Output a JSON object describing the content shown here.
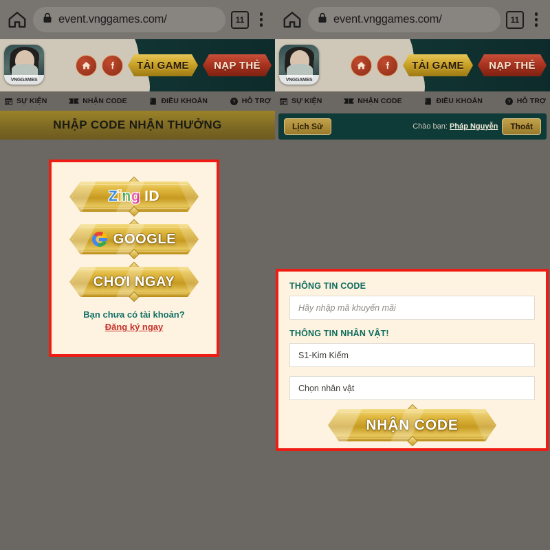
{
  "browser": {
    "url": "event.vnggames.com/",
    "tab_count": "11",
    "home_icon": "home-icon",
    "lock_icon": "lock-icon",
    "tabs_icon": "tab-counter-icon",
    "menu_icon": "kebab-menu-icon"
  },
  "game_header": {
    "logo_alt": "VNGGAMES",
    "logo_caption": "VNGGAMES",
    "home_icon": "home-icon",
    "facebook_icon": "facebook-icon",
    "download_label": "TẢI GAME",
    "topup_label": "NẠP THẺ"
  },
  "nav": [
    {
      "label": "SỰ KIỆN",
      "icon": "calendar-icon"
    },
    {
      "label": "NHẬN CODE",
      "icon": "ticket-icon"
    },
    {
      "label": "ĐIỀU KHOẢN",
      "icon": "book-icon"
    },
    {
      "label": "HỖ TRỢ",
      "icon": "question-circle-icon"
    }
  ],
  "left_panel": {
    "banner_title": "NHẬP CODE NHẬN THƯỞNG",
    "login": {
      "zing_z": "Z",
      "zing_i": "i",
      "zing_n": "n",
      "zing_g": "g",
      "zing_id": "ID",
      "google_label": "GOOGLE",
      "play_label": "CHƠI NGAY",
      "no_account_question": "Bạn chưa có tài khoản?",
      "register_link": "Đăng ký ngay"
    }
  },
  "right_panel": {
    "userbar": {
      "history_label": "Lịch Sử",
      "greeting_prefix": "Chào bạn:",
      "username": "Pháp Nguyễn",
      "logout_label": "Thoát"
    },
    "form": {
      "code_section": "THÔNG TIN CODE",
      "code_placeholder": "Hãy nhập mã khuyến mãi",
      "character_section": "THÔNG TIN NHÂN VẬT!",
      "server_value": "S1-Kim Kiếm",
      "character_value": "Chọn nhân vật",
      "submit_label": "NHẬN CODE"
    }
  },
  "colors": {
    "annotation_red": "#ee1c12",
    "page_background": "#6b6762",
    "header_teal": "#0d2b2a",
    "banner_olive": "#7e6a24",
    "userbar_teal": "#0e3b38",
    "gold": "#c79a20",
    "card_cream": "#fdf3e0",
    "section_green": "#0d6b5e",
    "link_red": "#c8302a"
  }
}
